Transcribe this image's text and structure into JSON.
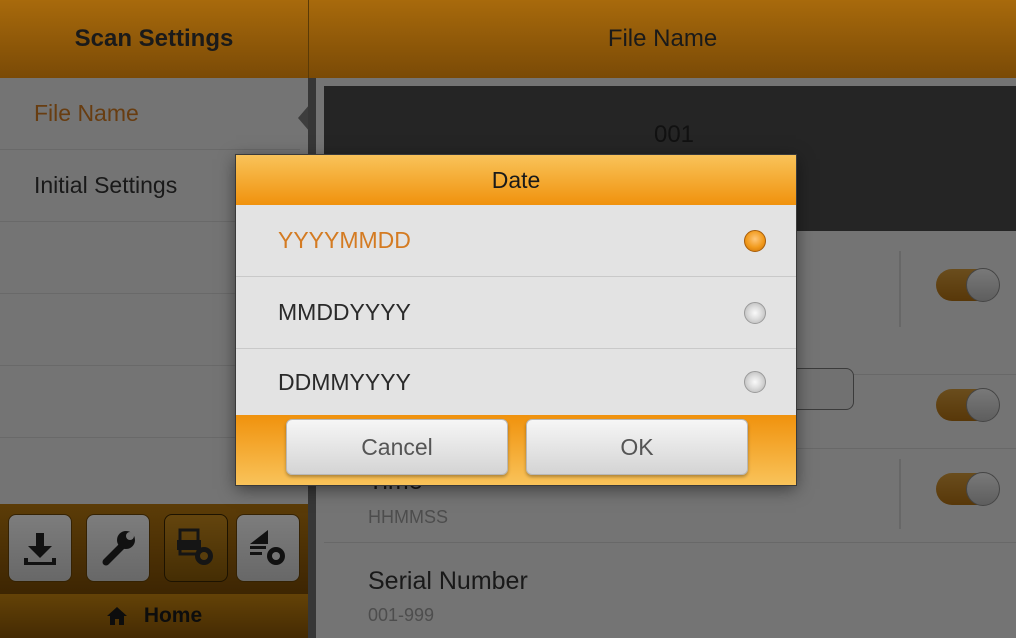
{
  "left": {
    "header": "Scan Settings",
    "items": [
      {
        "label": "File Name",
        "selected": true
      },
      {
        "label": "Initial Settings",
        "selected": false
      },
      {
        "label": "",
        "selected": false
      },
      {
        "label": "",
        "selected": false
      },
      {
        "label": "",
        "selected": false
      }
    ],
    "toolbar": [
      {
        "icon": "download-icon",
        "active": false
      },
      {
        "icon": "wrench-icon",
        "active": false
      },
      {
        "icon": "scan-settings-icon",
        "active": true
      },
      {
        "icon": "upload-settings-icon",
        "active": false
      }
    ],
    "home_label": "Home",
    "home_icon": "home-icon"
  },
  "right": {
    "header": "File Name",
    "preview_text": "001",
    "rows": [
      {
        "title": "",
        "sub": "",
        "toggle_on": true
      },
      {
        "title": "",
        "sub": "",
        "toggle_on": true
      },
      {
        "title": "Time",
        "sub": "HHMMSS",
        "toggle_on": true
      },
      {
        "title": "Serial Number",
        "sub": "001-999",
        "toggle_on": false
      }
    ]
  },
  "dialog": {
    "title": "Date",
    "options": [
      {
        "label": "YYYYMMDD",
        "selected": true
      },
      {
        "label": "MMDDYYYY",
        "selected": false
      },
      {
        "label": "DDMMYYYY",
        "selected": false
      }
    ],
    "cancel_label": "Cancel",
    "ok_label": "OK"
  },
  "colors": {
    "accent": "#F0920D",
    "header_brown": "#8A5606",
    "selected_text": "#D47B22"
  }
}
